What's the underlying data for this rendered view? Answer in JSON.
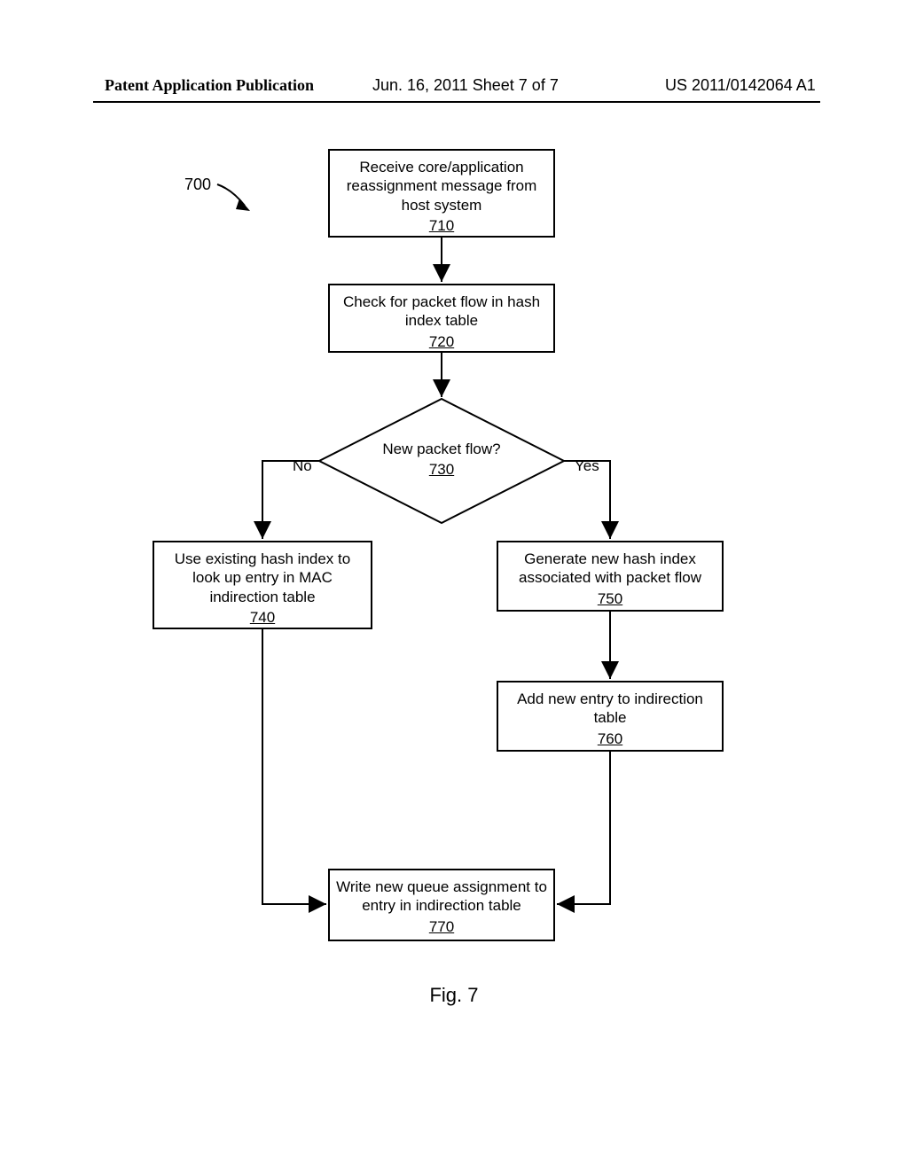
{
  "header": {
    "left": "Patent Application Publication",
    "center": "Jun. 16, 2011  Sheet 7 of 7",
    "right": "US 2011/0142064 A1"
  },
  "refLabel": "700",
  "decision": {
    "text": "New packet flow?",
    "ref": "730",
    "no": "No",
    "yes": "Yes"
  },
  "boxes": {
    "b710": {
      "text": "Receive core/application reassignment message from host system",
      "ref": "710"
    },
    "b720": {
      "text": "Check for packet flow in hash index table",
      "ref": "720"
    },
    "b740": {
      "text": "Use existing hash index to look up entry in MAC indirection table",
      "ref": "740"
    },
    "b750": {
      "text": "Generate new hash index associated with packet flow",
      "ref": "750"
    },
    "b760": {
      "text": "Add new entry to indirection table",
      "ref": "760"
    },
    "b770": {
      "text": "Write new queue assignment to entry in indirection table",
      "ref": "770"
    }
  },
  "figure": "Fig. 7"
}
